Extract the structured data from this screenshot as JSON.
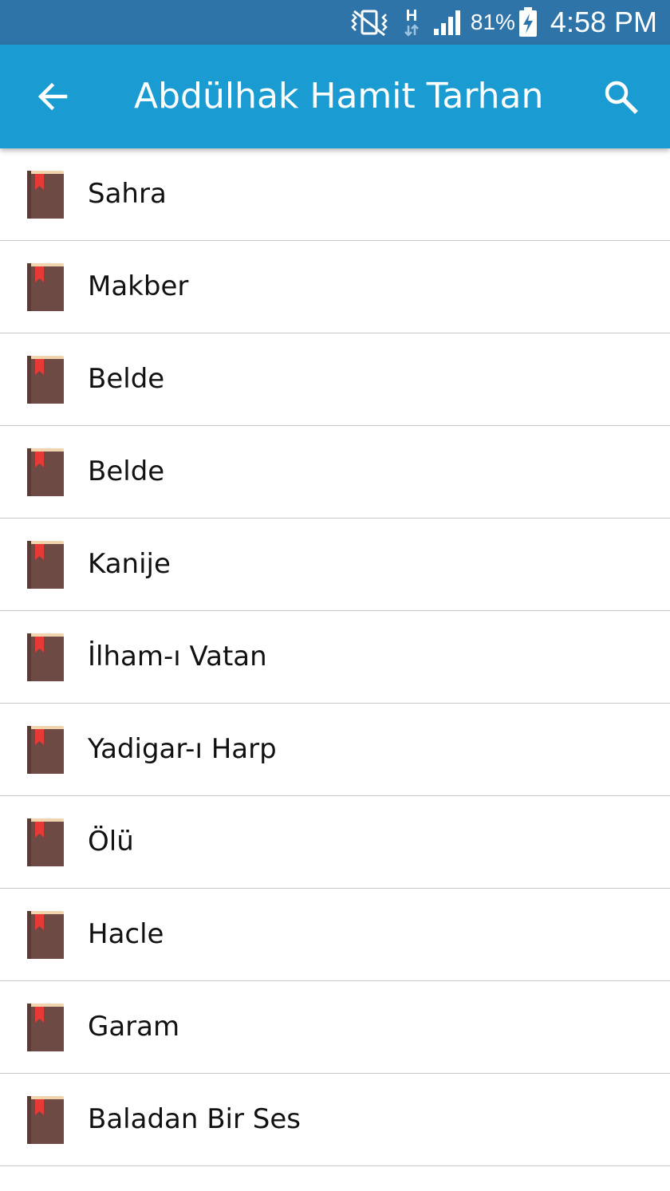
{
  "status_bar": {
    "battery_percent": "81%",
    "time": "4:58 PM",
    "network_type": "H",
    "icons": [
      "vibrate-icon",
      "network-h-icon",
      "signal-icon",
      "battery-charging-icon"
    ]
  },
  "app_bar": {
    "title": "Abdülhak Hamit Tarhan",
    "back_icon": "arrow-left-icon",
    "search_icon": "search-icon",
    "background_color": "#1a9bd1"
  },
  "list": {
    "item_icon": "book-icon",
    "items": [
      {
        "label": "Sahra"
      },
      {
        "label": "Makber"
      },
      {
        "label": "Belde"
      },
      {
        "label": "Belde"
      },
      {
        "label": "Kanije"
      },
      {
        "label": "İlham-ı Vatan"
      },
      {
        "label": "Yadigar-ı Harp"
      },
      {
        "label": "Ölü"
      },
      {
        "label": "Hacle"
      },
      {
        "label": "Garam"
      },
      {
        "label": "Baladan Bir Ses"
      }
    ]
  }
}
